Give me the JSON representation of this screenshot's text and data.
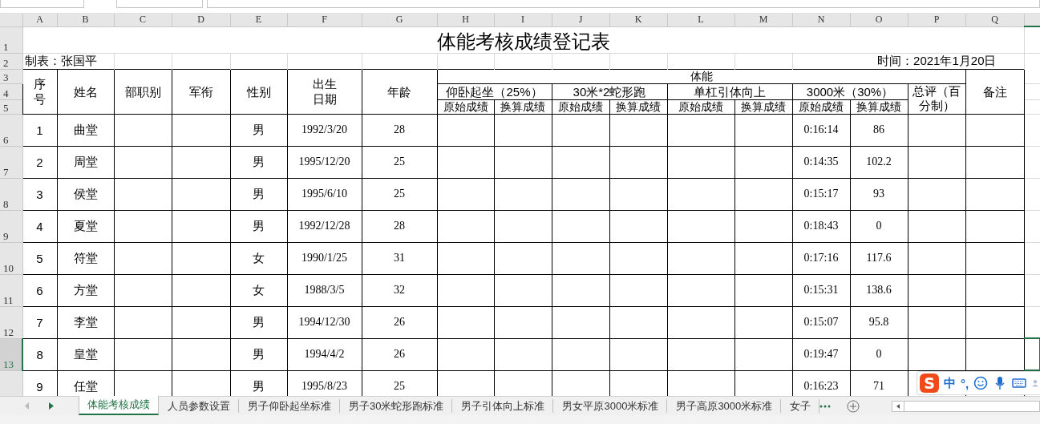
{
  "column_letters": [
    "A",
    "B",
    "C",
    "D",
    "E",
    "F",
    "G",
    "H",
    "I",
    "J",
    "K",
    "L",
    "M",
    "N",
    "O",
    "P",
    "Q"
  ],
  "header_row_numbers": [
    "1",
    "2",
    "3",
    "4",
    "5"
  ],
  "title": "体能考核成绩登记表",
  "maker": "制表：张国平",
  "date": "时间：2021年1月20日",
  "header": {
    "columns": [
      {
        "lines": [
          "序",
          "号"
        ]
      },
      {
        "lines": [
          "姓名"
        ]
      },
      {
        "lines": [
          "部职别"
        ]
      },
      {
        "lines": [
          "军衔"
        ]
      },
      {
        "lines": [
          "性别"
        ]
      },
      {
        "lines": [
          "出生",
          "日期"
        ]
      },
      {
        "lines": [
          "年龄"
        ]
      }
    ],
    "group": "体能",
    "subgroups": [
      {
        "label": "仰卧起坐（25%）",
        "subs": [
          "原始成绩",
          "换算成绩"
        ]
      },
      {
        "label": "30米*2蛇形跑",
        "subs": [
          "原始成绩",
          "换算成绩"
        ]
      },
      {
        "label": "单杠引体向上",
        "subs": [
          "原始成绩",
          "换算成绩"
        ]
      },
      {
        "label": "3000米（30%）",
        "subs": [
          "原始成绩",
          "换算成绩"
        ]
      }
    ],
    "total": "总评（百分制）",
    "remark": "备注"
  },
  "rows": [
    {
      "row_number": "6",
      "selected": false,
      "seq": "1",
      "name": "曲堂",
      "gender": "男",
      "birth": "1992/3/20",
      "age": "28",
      "run_raw": "0:16:14",
      "run_score": "86"
    },
    {
      "row_number": "7",
      "selected": false,
      "seq": "2",
      "name": "周堂",
      "gender": "男",
      "birth": "1995/12/20",
      "age": "25",
      "run_raw": "0:14:35",
      "run_score": "102.2"
    },
    {
      "row_number": "8",
      "selected": false,
      "seq": "3",
      "name": "侯堂",
      "gender": "男",
      "birth": "1995/6/10",
      "age": "25",
      "run_raw": "0:15:17",
      "run_score": "93"
    },
    {
      "row_number": "9",
      "selected": false,
      "seq": "4",
      "name": "夏堂",
      "gender": "男",
      "birth": "1992/12/28",
      "age": "28",
      "run_raw": "0:18:43",
      "run_score": "0"
    },
    {
      "row_number": "10",
      "selected": false,
      "seq": "5",
      "name": "符堂",
      "gender": "女",
      "birth": "1990/1/25",
      "age": "31",
      "run_raw": "0:17:16",
      "run_score": "117.6"
    },
    {
      "row_number": "11",
      "selected": false,
      "seq": "6",
      "name": "方堂",
      "gender": "女",
      "birth": "1988/3/5",
      "age": "32",
      "run_raw": "0:15:31",
      "run_score": "138.6"
    },
    {
      "row_number": "12",
      "selected": false,
      "seq": "7",
      "name": "李堂",
      "gender": "男",
      "birth": "1994/12/30",
      "age": "26",
      "run_raw": "0:15:07",
      "run_score": "95.8"
    },
    {
      "row_number": "13",
      "selected": true,
      "seq": "8",
      "name": "皇堂",
      "gender": "男",
      "birth": "1994/4/2",
      "age": "26",
      "run_raw": "0:19:47",
      "run_score": "0"
    },
    {
      "selected": false,
      "seq": "9",
      "name": "任堂",
      "gender": "男",
      "birth": "1995/8/23",
      "age": "25",
      "run_raw": "0:16:23",
      "run_score": "71"
    }
  ],
  "sheet_tabs": [
    {
      "label": "体能考核成绩",
      "selected": true
    },
    {
      "label": "人员参数设置",
      "selected": false
    },
    {
      "label": "男子仰卧起坐标准",
      "selected": false
    },
    {
      "label": "男子30米蛇形跑标准",
      "selected": false
    },
    {
      "label": "男子引体向上标准",
      "selected": false
    },
    {
      "label": "男女平原3000米标准",
      "selected": false
    },
    {
      "label": "男子高原3000米标准",
      "selected": false
    },
    {
      "label": "女子",
      "selected": false
    }
  ],
  "ime": {
    "logo": "S",
    "mode": "中",
    "punct": "°,"
  }
}
